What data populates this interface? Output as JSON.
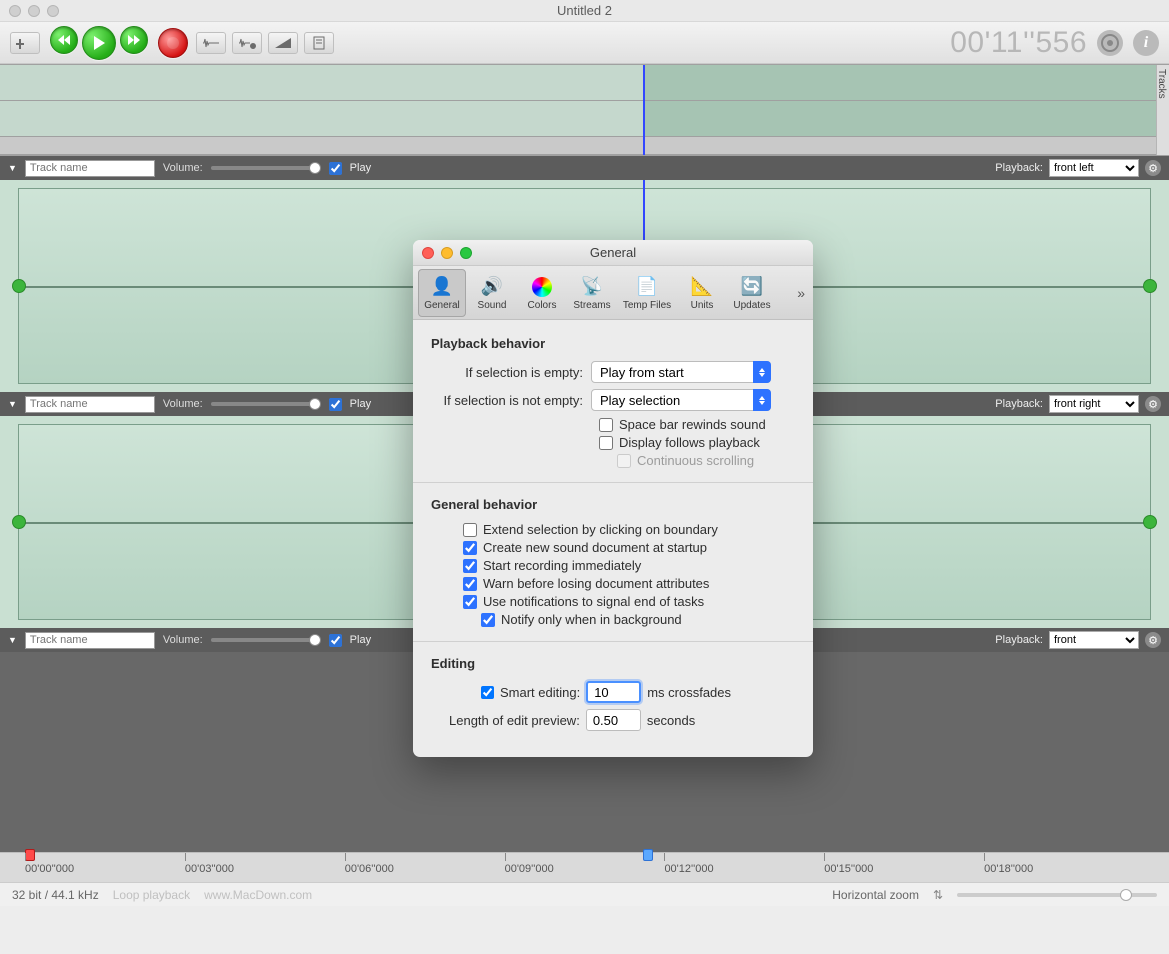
{
  "window": {
    "title": "Untitled 2",
    "time_display": "00'11''556"
  },
  "ruler": {
    "ticks": [
      "00'00''000",
      "00'03''000",
      "00'06''000",
      "00'09''000",
      "00'12''000",
      "00'15''000",
      "00'18''000"
    ]
  },
  "footer": {
    "format": "32 bit / 44.1 kHz",
    "mode": "Loop playback",
    "watermark": "www.MacDown.com",
    "zoom_label": "Horizontal zoom"
  },
  "track_header": {
    "name_placeholder": "Track name",
    "volume": "Volume:",
    "play": "Play",
    "playback_label": "Playback:",
    "outputs": [
      "front left",
      "front right",
      "front"
    ]
  },
  "overview_side_label": "Tracks",
  "dialog": {
    "title": "General",
    "tabs": [
      "General",
      "Sound",
      "Colors",
      "Streams",
      "Temp Files",
      "Units",
      "Updates"
    ],
    "sections": {
      "playback": {
        "title": "Playback behavior",
        "empty_label": "If selection is empty:",
        "empty_value": "Play from start",
        "notempty_label": "If selection is not empty:",
        "notempty_value": "Play selection",
        "opts": {
          "space_rewind": "Space bar rewinds sound",
          "display_follows": "Display follows playback",
          "continuous": "Continuous scrolling"
        }
      },
      "general": {
        "title": "General behavior",
        "opts": {
          "extend": "Extend selection by clicking on boundary",
          "create": "Create new sound document at startup",
          "startrec": "Start recording immediately",
          "warn": "Warn before losing document attributes",
          "notify": "Use notifications to signal end of tasks",
          "notifybg": "Notify only when in background"
        }
      },
      "editing": {
        "title": "Editing",
        "smart": "Smart editing:",
        "smart_value": "10",
        "smart_suffix": "ms crossfades",
        "preview_label": "Length of edit preview:",
        "preview_value": "0.50",
        "preview_suffix": "seconds"
      }
    }
  }
}
